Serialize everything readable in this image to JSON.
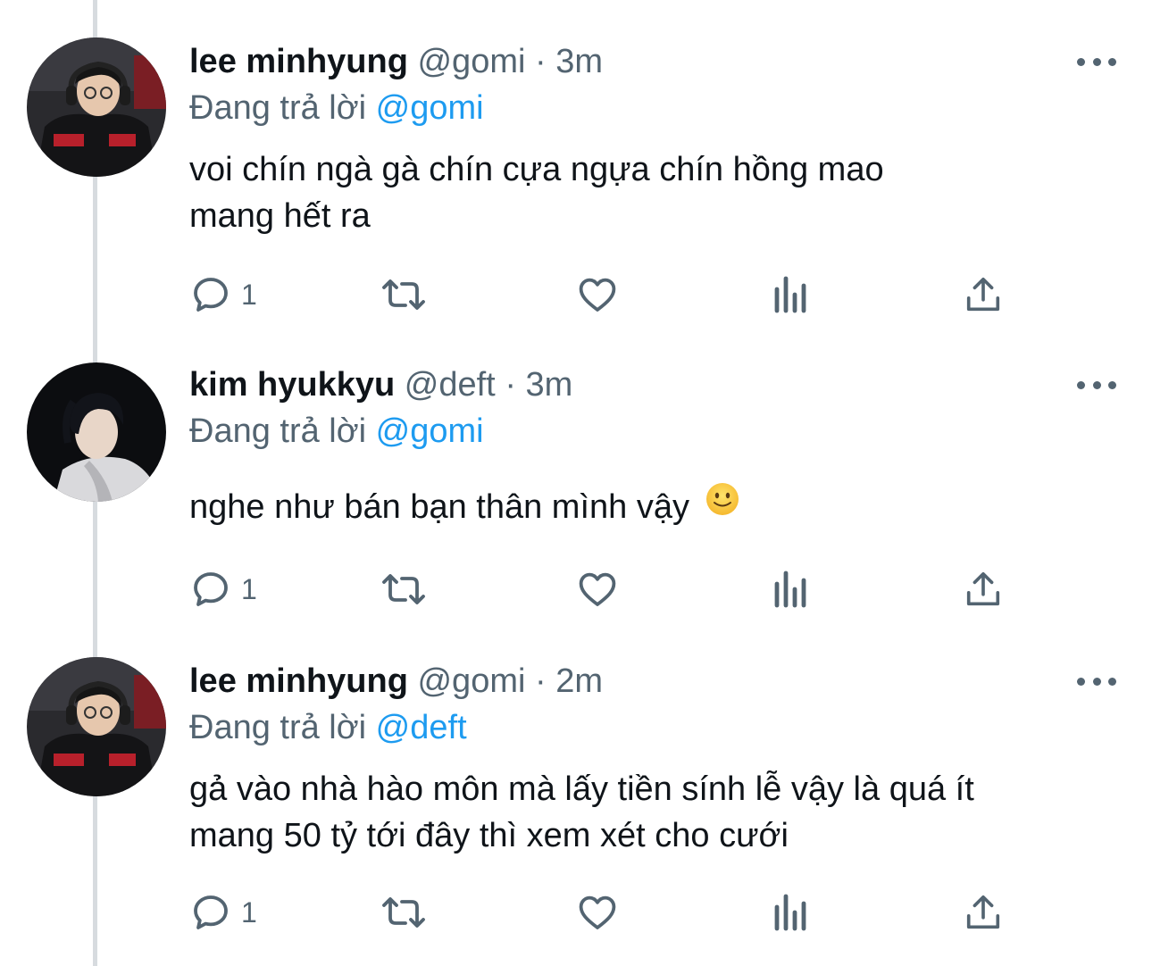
{
  "reply_prefix": "Đang trả lời",
  "tweets": [
    {
      "display_name": "lee minhyung",
      "handle": "@gomi",
      "separator": "·",
      "time": "3m",
      "reply_to": "@gomi",
      "text_lines": [
        "voi chín ngà gà chín cựa ngựa chín hồng mao",
        "mang hết ra"
      ],
      "reply_count": "1"
    },
    {
      "display_name": "kim hyukkyu",
      "handle": "@deft",
      "separator": "·",
      "time": "3m",
      "reply_to": "@gomi",
      "text_lines": [
        "nghe như bán bạn thân mình vậy"
      ],
      "emoji": "slightly-smiling-face-icon",
      "reply_count": "1"
    },
    {
      "display_name": "lee minhyung",
      "handle": "@gomi",
      "separator": "·",
      "time": "2m",
      "reply_to": "@deft",
      "text_lines": [
        "gả vào nhà hào môn mà lấy tiền sính lễ vậy là quá ít",
        "mang 50 tỷ tới đây thì xem xét cho cưới"
      ],
      "reply_count": "1"
    }
  ],
  "colors": {
    "accent": "#1d9bf0",
    "secondary_text": "#536471",
    "primary_text": "#0f1419",
    "thread_line": "#d7dbdf"
  },
  "icons": [
    "reply-icon",
    "retweet-icon",
    "like-icon",
    "analytics-icon",
    "share-icon",
    "more-icon"
  ]
}
